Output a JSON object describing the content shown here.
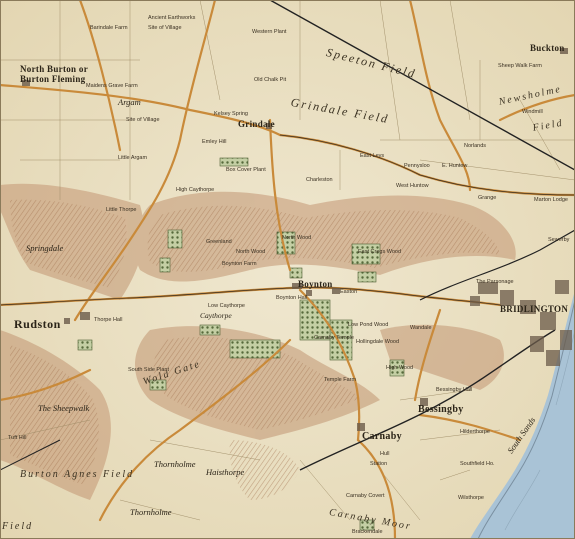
{
  "map": {
    "colors": {
      "paper": "#ece3c9",
      "hills": "#b98a64",
      "roads": "#b87a32",
      "woods": "#8a9a6a",
      "sea": "#a9c3d6",
      "rail": "#222222"
    },
    "towns": {
      "rudston": "Rudston",
      "bridlington": "BRIDLINGTON",
      "boynton": "Boynton",
      "bessingby": "Bessingby",
      "carnaby": "Carnaby",
      "north_burton_1": "North Burton or",
      "north_burton_2": "Burton Fleming",
      "grindale": "Grindale",
      "buckton": "Buckton"
    },
    "fields": {
      "speeton_field": "Speeton Field",
      "grindale_field": "Grindale Field",
      "wold_gate": "Wold Gate",
      "burton_agnes_field": "Burton Agnes Field",
      "carnaby_moor": "Carnaby Moor",
      "newsholme": "Newsholme",
      "field_right": "Field",
      "field_left": "Field",
      "south_sands": "South Sands"
    },
    "places": {
      "barindale": "Barindale Farm",
      "site_village": "Site of Village",
      "ancient_earthworks": "Ancient Earthworks",
      "western_plant": "Western Plant",
      "old_chalk_pit": "Old Chalk Pit",
      "kelsey_spring": "Kelsey Spring",
      "maidens_grave": "Maidens Grave Farm",
      "argam": "Argam",
      "emley_hill": "Emley Hill",
      "site_argam": "Site of Village",
      "little_argam": "Little Argam",
      "box_cover": "Box Cover Plant",
      "high_caythorpe": "High Caythorpe",
      "little_thorpe": "Little Thorpe",
      "springdale": "Springdale",
      "greenland": "Greenland",
      "north_wood": "North Wood",
      "north_wood2": "North Wood",
      "east_cregs": "East Cregs Wood",
      "easton": "Easton",
      "boynton_hall": "Boynton Hall",
      "low_caythorpe": "Low Caythorpe",
      "caythorpe": "Caythorpe",
      "thorpe_hall": "Thorpe Hall",
      "the_sheepwalk": "The Sheepwalk",
      "tuft_hill": "Tuft Hill",
      "south_side_plant": "South Side Plant",
      "carnaby_temple": "Carnaby Temple",
      "temple_farm": "Temple Farm",
      "hollingdale": "Hollingdale Wood",
      "low_pond_wood": "Low Pond Wood",
      "wandale": "Wandale",
      "high_wood": "High Wood",
      "bessingby_hall": "Bessingby Hall",
      "thornholme": "Thornholme",
      "thornholme2": "Thornholme",
      "haisthorpe": "Haisthorpe",
      "hilderthorpe": "Hilderthorpe",
      "southfield": "Southfield Ho.",
      "wilsthorpe": "Wilsthorpe",
      "charleston": "Charleston",
      "east_leys": "East Leys",
      "norlands": "Norlands",
      "west_huntow": "West Huntow",
      "grange": "Grange",
      "the_parsonage": "The Parsonage",
      "marton_lodge": "Marton Lodge",
      "sewerby": "Sewerby",
      "windmill": "Windmill",
      "sheep_walk_farm": "Sheep Walk Farm",
      "e_huntow": "E. Huntow",
      "pennysloo": "Pennysloo",
      "boynton_farm": "Boynton Farm",
      "brackendale": "Brackendale",
      "carnaby_covert": "Carnaby Covert",
      "station": "Station",
      "hull": "Hull"
    }
  }
}
